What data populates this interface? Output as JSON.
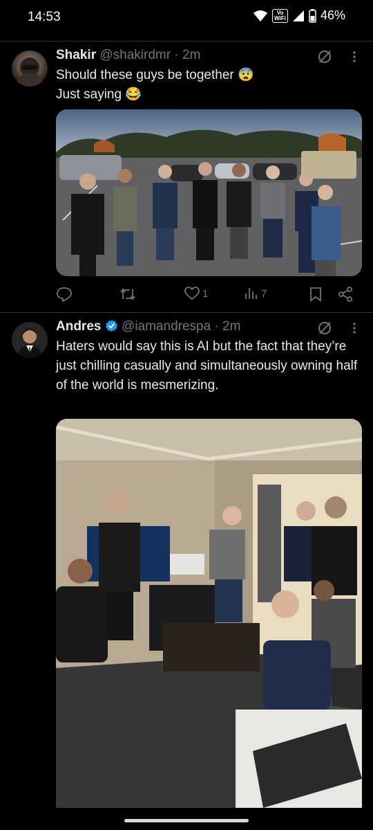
{
  "status_bar": {
    "time": "14:53",
    "vowifi_top": "Vo",
    "vowifi_bottom": "WiFi",
    "battery": "46%"
  },
  "tweets": [
    {
      "name": "Shakir",
      "handle": "@shakirdmr",
      "time": "· 2m",
      "verified": false,
      "lines": [
        "Should these guys be together 😨",
        "Just saying 😂"
      ],
      "actions": {
        "replies": "",
        "reposts": "",
        "likes": "1",
        "views": "7"
      }
    },
    {
      "name": "Andres",
      "handle": "@iamandrespa",
      "time": "· 2m",
      "verified": true,
      "text": "Haters would say this is AI but the fact that they’re just chilling casually and simultaneously owning half of the world is mesmerizing."
    }
  ],
  "colors": {
    "background": "#000000",
    "verified": "#1d9bf0",
    "muted": "#71767b"
  },
  "icons": [
    "wifi-icon",
    "signal-icon",
    "battery-icon",
    "grok-icon",
    "more-icon",
    "reply-icon",
    "repost-icon",
    "like-icon",
    "views-icon",
    "bookmark-icon",
    "share-icon",
    "verified-badge-icon"
  ]
}
